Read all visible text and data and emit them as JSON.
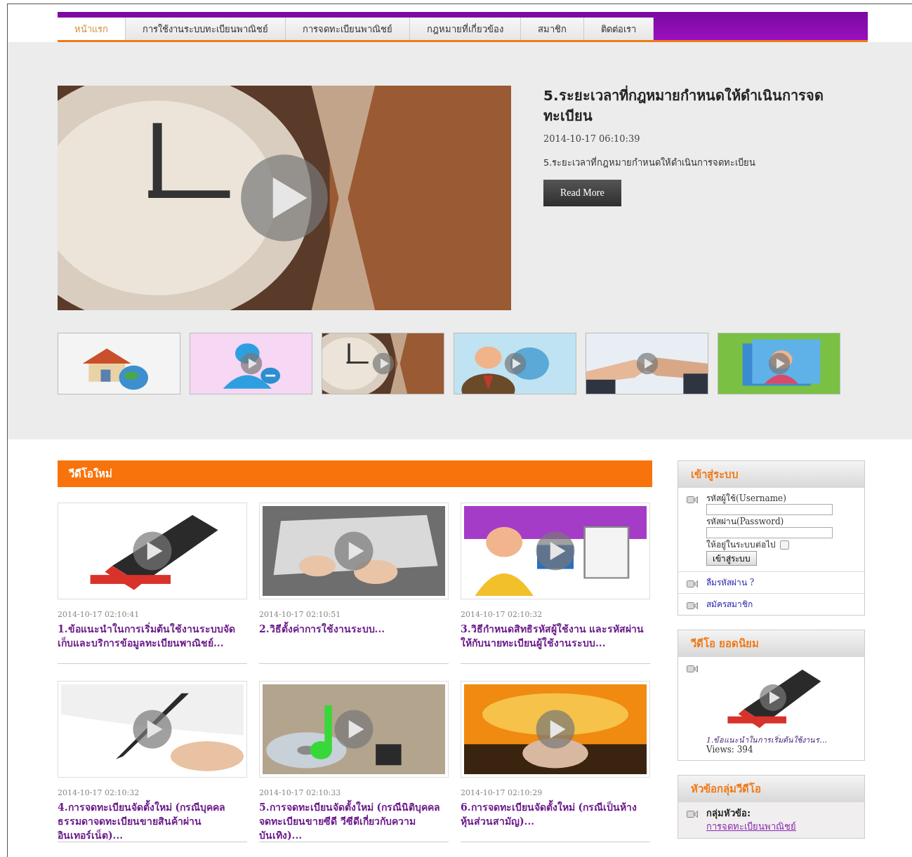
{
  "nav": {
    "tabs": [
      {
        "label": "หน้าแรก",
        "selected": true
      },
      {
        "label": "การใช้งานระบบทะเบียนพาณิชย์",
        "selected": false
      },
      {
        "label": "การจดทะเบียนพาณิชย์",
        "selected": false
      },
      {
        "label": "กฎหมายที่เกี่ยวข้อง",
        "selected": false
      },
      {
        "label": "สมาชิก",
        "selected": false
      },
      {
        "label": "ติดต่อเรา",
        "selected": false
      }
    ]
  },
  "featured": {
    "title": "5.ระยะเวลาที่กฎหมายกำหนดให้ดำเนินการจดทะเบียน",
    "date": "2014-10-17 06:10:39",
    "summary": "5.ระยะเวลาที่กฎหมายกำหนดให้ดำเนินการจดทะเบียน",
    "button": "Read More"
  },
  "new_videos": {
    "heading": "วีดีโอใหม่",
    "items": [
      {
        "date": "2014-10-17 02:10:41",
        "title": "1.ข้อแนะนำในการเริ่มต้นใช้งานระบบจัดเก็บและบริการข้อมูลทะเบียนพาณิชย์..."
      },
      {
        "date": "2014-10-17 02:10:51",
        "title": "2.วิธีตั้งค่าการใช้งานระบบ..."
      },
      {
        "date": "2014-10-17 02:10:32",
        "title": "3.วิธีกำหนดสิทธิรหัสผู้ใช้งาน และรหัสผ่านให้กับนายทะเบียนผู้ใช้งานระบบ..."
      },
      {
        "date": "2014-10-17 02:10:32",
        "title": "4.การจดทะเบียนจัดตั้งใหม่ (กรณีบุคคลธรรมดาจดทะเบียนขายสินค้าผ่านอินเทอร์เน็ต)..."
      },
      {
        "date": "2014-10-17 02:10:33",
        "title": "5.การจดทะเบียนจัดตั้งใหม่ (กรณีนิติบุคคลจดทะเบียนขายซีดี วีซีดีเกี่ยวกับความบันเทิง)..."
      },
      {
        "date": "2014-10-17 02:10:29",
        "title": "6.การจดทะเบียนจัดตั้งใหม่ (กรณีเป็นห้างหุ้นส่วนสามัญ)..."
      }
    ]
  },
  "login": {
    "heading": "เข้าสู่ระบบ",
    "username_label": "รหัสผู้ใช้(Username)",
    "password_label": "รหัสผ่าน(Password)",
    "remember_label": "ให้อยู่ในระบบต่อไป",
    "remember_checked": false,
    "submit": "เข้าสู่ระบบ",
    "links": [
      "ลืมรหัสผ่าน ?",
      "สมัครสมาชิก"
    ]
  },
  "popular": {
    "heading": "วีดีโอ ยอดนิยม",
    "caption": "1.ข้อแนะนำในการเริ่มต้นใช้งานร...",
    "views": "Views: 394"
  },
  "groups": {
    "heading": "หัวข้อกลุ่มวีดีโอ",
    "label": "กลุ่มหัวข้อ:",
    "link": "การจดทะเบียนพาณิชย์"
  }
}
